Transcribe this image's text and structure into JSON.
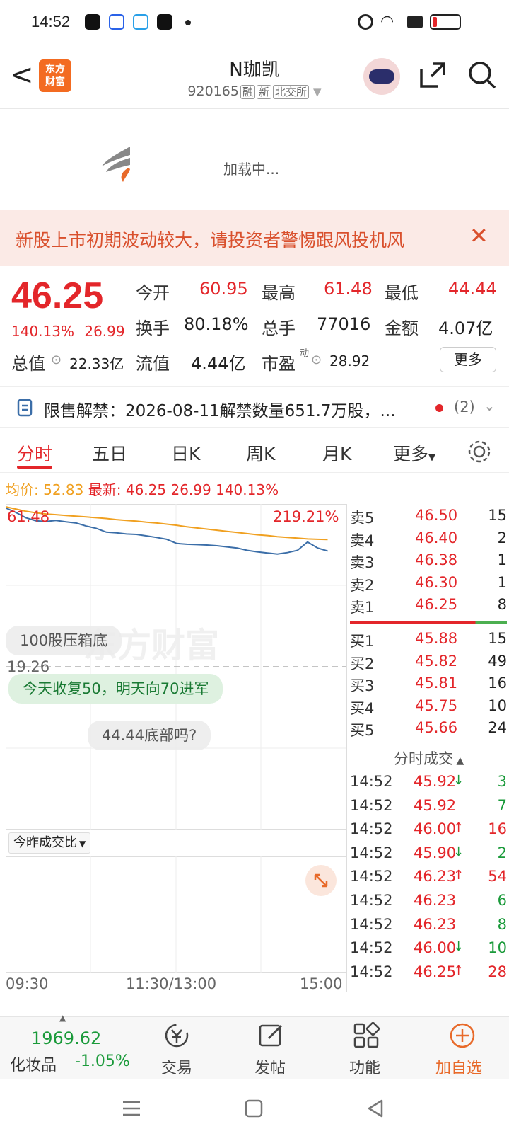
{
  "status_bar": {
    "time": "14:52"
  },
  "header": {
    "back": "<",
    "logo_line1": "东方",
    "logo_line2": "财富",
    "stock_name": "N珈凯",
    "stock_code": "920165",
    "tags": [
      "融",
      "新",
      "北交所"
    ]
  },
  "loading": {
    "text": "加载中..."
  },
  "warning": {
    "text": "新股上市初期波动较大，请投资者警惕跟风投机风",
    "close": "✕"
  },
  "quote": {
    "price": "46.25",
    "change_pct": "140.13%",
    "change": "26.99",
    "open_label": "今开",
    "open": "60.95",
    "high_label": "最高",
    "high": "61.48",
    "low_label": "最低",
    "low": "44.44",
    "turnover_label": "换手",
    "turnover": "80.18%",
    "volume_label": "总手",
    "volume": "77016",
    "amount_label": "金额",
    "amount": "4.07亿",
    "mktcap_label": "总值",
    "mktcap": "22.33亿",
    "float_label": "流值",
    "float": "4.44亿",
    "pe_label": "市盈",
    "pe_sup": "动",
    "pe": "28.92",
    "more": "更多"
  },
  "restricted": {
    "text": "限售解禁：2026-08-11解禁数量651.7万股，...",
    "count": "(2)"
  },
  "tabs": [
    "分时",
    "五日",
    "日K",
    "周K",
    "月K",
    "更多"
  ],
  "avg_bar": {
    "avg_label": "均价:",
    "avg": "52.83",
    "latest_label": "最新:",
    "latest": "46.25",
    "change": "26.99",
    "pct": "140.13%"
  },
  "chart": {
    "top_price": "61.48",
    "top_pct": "219.21%",
    "ref_price": "19.26",
    "watermark": "东方财富",
    "bubbles": [
      "100股压箱底",
      "今天收复50，明天向70进军",
      "44.44底部吗?"
    ],
    "vol_selector": "今昨成交比",
    "time_axis": [
      "09:30",
      "11:30/13:00",
      "15:00"
    ]
  },
  "chart_data": {
    "type": "line",
    "series": [
      {
        "values": [
          61.2,
          60.0,
          58.6,
          57.8,
          57.6,
          57.9,
          57.5,
          57.2,
          56.4,
          55.8,
          54.8,
          54.6,
          54.3,
          54.2,
          53.8,
          53.4,
          52.9,
          51.8,
          51.6,
          51.5,
          51.4,
          51.2,
          50.9,
          50.6,
          50.0,
          49.6,
          49.3,
          49.0,
          49.4,
          50.0,
          52.2,
          50.6,
          49.8
        ]
      },
      {
        "values": [
          61.48,
          60.9,
          60.3,
          59.9,
          59.6,
          59.4,
          59.2,
          59.0,
          58.8,
          58.6,
          58.4,
          58.1,
          57.9,
          57.7,
          57.4,
          57.2,
          56.9,
          56.6,
          56.2,
          55.9,
          55.6,
          55.3,
          55.0,
          54.7,
          54.4,
          54.1,
          53.9,
          53.6,
          53.4,
          53.2,
          53.0,
          52.9,
          52.83
        ]
      }
    ],
    "ylim": [
      19.26,
      61.48
    ]
  },
  "order_book": {
    "sell": [
      {
        "label": "卖5",
        "price": "46.50",
        "qty": "15"
      },
      {
        "label": "卖4",
        "price": "46.40",
        "qty": "2"
      },
      {
        "label": "卖3",
        "price": "46.38",
        "qty": "1"
      },
      {
        "label": "卖2",
        "price": "46.30",
        "qty": "1"
      },
      {
        "label": "卖1",
        "price": "46.25",
        "qty": "8"
      }
    ],
    "buy": [
      {
        "label": "买1",
        "price": "45.88",
        "qty": "15"
      },
      {
        "label": "买2",
        "price": "45.82",
        "qty": "49"
      },
      {
        "label": "买3",
        "price": "45.81",
        "qty": "16"
      },
      {
        "label": "买4",
        "price": "45.75",
        "qty": "10"
      },
      {
        "label": "买5",
        "price": "45.66",
        "qty": "24"
      }
    ],
    "trades_title": "分时成交",
    "trades": [
      {
        "time": "14:52",
        "price": "45.92",
        "dir": "↓",
        "qty": "3",
        "color": "green"
      },
      {
        "time": "14:52",
        "price": "45.92",
        "dir": "",
        "qty": "7",
        "color": "green"
      },
      {
        "time": "14:52",
        "price": "46.00",
        "dir": "↑",
        "qty": "16",
        "color": "red"
      },
      {
        "time": "14:52",
        "price": "45.90",
        "dir": "↓",
        "qty": "2",
        "color": "green"
      },
      {
        "time": "14:52",
        "price": "46.23",
        "dir": "↑",
        "qty": "54",
        "color": "red"
      },
      {
        "time": "14:52",
        "price": "46.23",
        "dir": "",
        "qty": "6",
        "color": "green"
      },
      {
        "time": "14:52",
        "price": "46.23",
        "dir": "",
        "qty": "8",
        "color": "green"
      },
      {
        "time": "14:52",
        "price": "46.00",
        "dir": "↓",
        "qty": "10",
        "color": "green"
      },
      {
        "time": "14:52",
        "price": "46.25",
        "dir": "↑",
        "qty": "28",
        "color": "red"
      }
    ]
  },
  "bottom_nav": {
    "index_value": "1969.62",
    "index_name": "化妆品",
    "index_change": "-1.05%",
    "items": [
      "交易",
      "发帖",
      "功能",
      "加自选"
    ]
  },
  "colors": {
    "red": "#e3262a",
    "green": "#1a9a3a",
    "orange": "#f0a020",
    "blue": "#3b6ea8"
  }
}
